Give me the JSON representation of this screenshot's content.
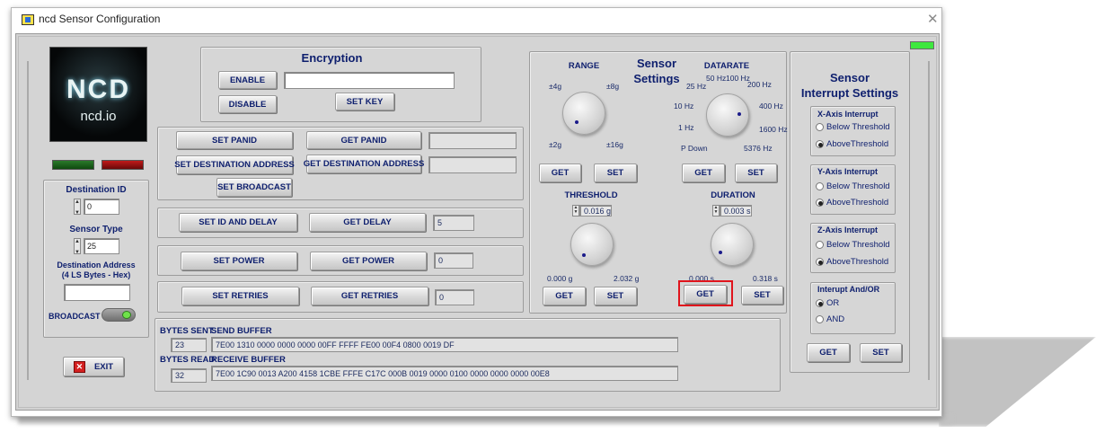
{
  "window": {
    "title": "ncd Sensor Configuration"
  },
  "logo": {
    "brand": "NCD",
    "site": "ncd.io"
  },
  "encryption": {
    "title": "Encryption",
    "enable": "ENABLE",
    "disable": "DISABLE",
    "set_key": "SET KEY",
    "key_value": ""
  },
  "network": {
    "set_panid": "SET PANID",
    "get_panid": "GET PANID",
    "panid_value": "",
    "set_dest": "SET DESTINATION ADDRESS",
    "get_dest": "GET DESTINATION ADDRESS",
    "dest_value": "",
    "set_broadcast": "SET BROADCAST"
  },
  "delay": {
    "set": "SET ID AND DELAY",
    "get": "GET DELAY",
    "value": "5"
  },
  "power": {
    "set": "SET POWER",
    "get": "GET POWER",
    "value": "0"
  },
  "retries": {
    "set": "SET RETRIES",
    "get": "GET RETRIES",
    "value": "0"
  },
  "left": {
    "dest_id_label": "Destination ID",
    "dest_id": "0",
    "sensor_type_label": "Sensor Type",
    "sensor_type": "25",
    "dest_addr_label_1": "Destination Address",
    "dest_addr_label_2": "(4 LS Bytes - Hex)",
    "dest_addr": "",
    "broadcast_label": "BROADCAST",
    "exit": "EXIT"
  },
  "buffers": {
    "bytes_sent_label": "BYTES SENT",
    "bytes_sent": "23",
    "send_label": "SEND BUFFER",
    "send_value": "7E00 1310 0000 0000 0000 00FF FFFF FE00 00F4 0800 0019 DF",
    "bytes_read_label": "BYTES READ",
    "bytes_read": "32",
    "receive_label": "RECEIVE BUFFER",
    "receive_value": "7E00 1C90 0013 A200 4158 1CBE FFFE C17C 000B 0019 0000 0100 0000 0000 0000 00E8"
  },
  "sensor": {
    "title_1": "Sensor",
    "title_2": "Settings",
    "range": {
      "label": "RANGE",
      "t1": "±4g",
      "t2": "±8g",
      "t3": "±2g",
      "t4": "±16g",
      "get": "GET",
      "set": "SET"
    },
    "datarate": {
      "label": "DATARATE",
      "l1": "50 Hz",
      "l2": "100 Hz",
      "l3": "25 Hz",
      "l4": "200 Hz",
      "l5": "10 Hz",
      "l6": "400 Hz",
      "l7": "1 Hz",
      "l8": "1600 Hz",
      "l9": "P Down",
      "l10": "5376 Hz",
      "get": "GET",
      "set": "SET"
    },
    "threshold": {
      "label": "THRESHOLD",
      "value": "0.016 g",
      "min": "0.000 g",
      "max": "2.032 g",
      "get": "GET",
      "set": "SET"
    },
    "duration": {
      "label": "DURATION",
      "value": "0.003 s",
      "min": "0.000 s",
      "max": "0.318 s",
      "get": "GET",
      "set": "SET"
    }
  },
  "interrupt": {
    "title_1": "Sensor",
    "title_2": "Interrupt Settings",
    "x": {
      "label": "X-Axis Interrupt",
      "below": "Below Threshold",
      "above": "AboveThreshold"
    },
    "y": {
      "label": "Y-Axis Interrupt",
      "below": "Below Threshold",
      "above": "AboveThreshold"
    },
    "z": {
      "label": "Z-Axis Interrupt",
      "below": "Below Threshold",
      "above": "AboveThreshold"
    },
    "andor": {
      "label": "Interupt And/OR",
      "or": "OR",
      "and": "AND"
    },
    "get": "GET",
    "set": "SET"
  },
  "colors": {
    "label_text": "#0e1f6e",
    "highlight": "#e0141c",
    "led_green": "#2bd62b",
    "led_red": "#b01010"
  }
}
